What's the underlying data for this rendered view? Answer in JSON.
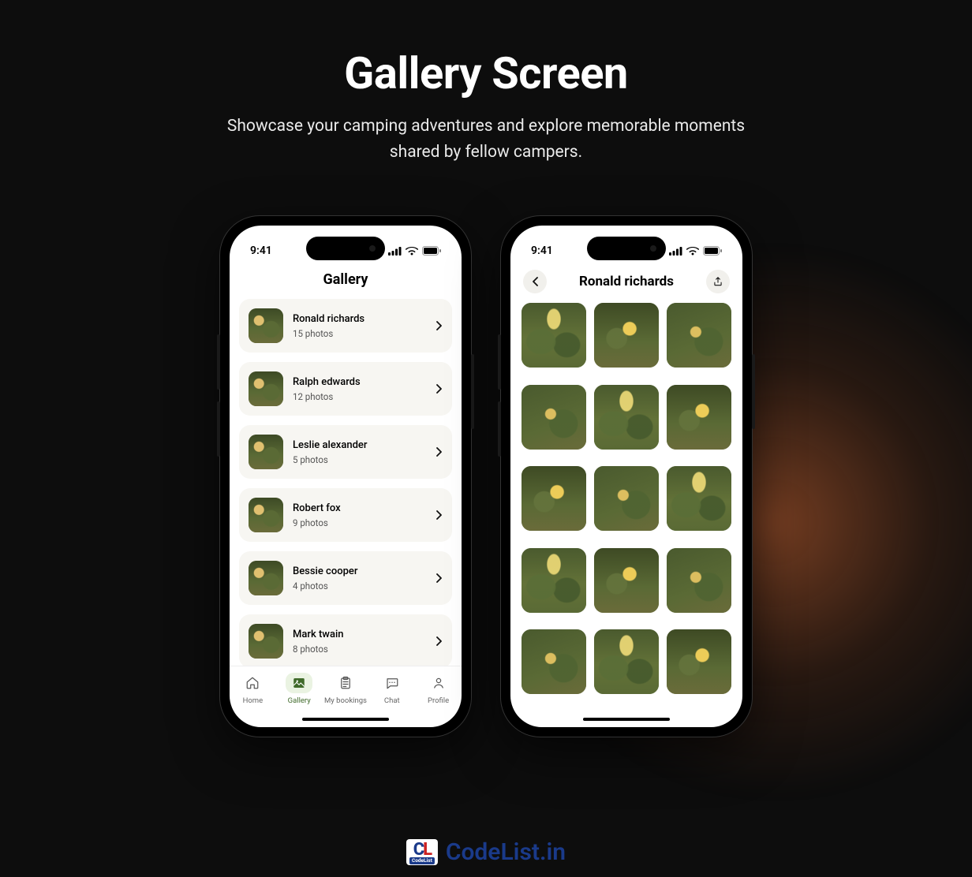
{
  "hero": {
    "title": "Gallery Screen",
    "subtitle": "Showcase your camping adventures and explore memorable moments shared by fellow campers."
  },
  "status": {
    "time": "9:41"
  },
  "gallery_list": {
    "title": "Gallery",
    "items": [
      {
        "name": "Ronald richards",
        "count": "15 photos"
      },
      {
        "name": "Ralph edwards",
        "count": "12 photos"
      },
      {
        "name": "Leslie alexander",
        "count": "5 photos"
      },
      {
        "name": "Robert fox",
        "count": "9 photos"
      },
      {
        "name": "Bessie cooper",
        "count": "4 photos"
      },
      {
        "name": "Mark twain",
        "count": "8 photos"
      }
    ]
  },
  "tabs": {
    "home": "Home",
    "gallery": "Gallery",
    "bookings": "My bookings",
    "chat": "Chat",
    "profile": "Profile"
  },
  "detail": {
    "title": "Ronald richards"
  },
  "watermark": {
    "badge_sub": "CodeList",
    "text": "CodeList.in"
  }
}
